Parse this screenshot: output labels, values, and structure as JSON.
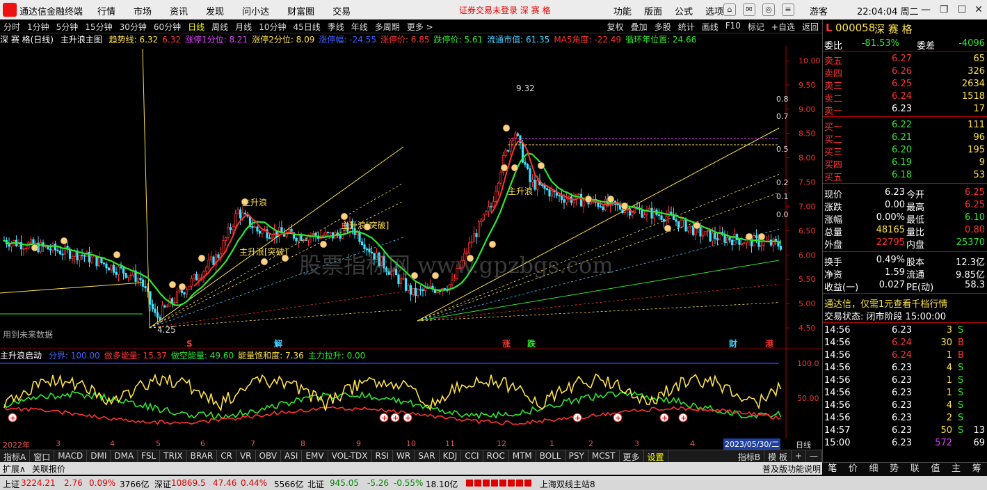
{
  "app": {
    "name": "通达信金融终端",
    "menu": [
      "行情",
      "市场",
      "资讯",
      "发现",
      "问小达",
      "财富圈",
      "交易"
    ],
    "warning": "证券交易未登录 深 赛 格",
    "menu2": [
      "功能",
      "版面",
      "公式",
      "选项"
    ],
    "user": "游客",
    "clock": "22:04:04 周二"
  },
  "periods": {
    "items": [
      "分时",
      "1分钟",
      "5分钟",
      "15分钟",
      "30分钟",
      "60分钟",
      "日线",
      "周线",
      "月线",
      "10分钟",
      "45日线",
      "季线",
      "年线",
      "多周期",
      "更多 >"
    ],
    "active": "日线",
    "right": [
      "复权",
      "叠加",
      "多股",
      "统计",
      "画线",
      "F10",
      "标记",
      "+自选",
      "返回"
    ]
  },
  "main_indicator": {
    "title": "深 赛 格(日线)",
    "formula": "主升浪主图",
    "items": [
      {
        "t": "趋势线: 6.32",
        "c": "#ffe14a"
      },
      {
        "t": "6.32",
        "c": "#ff3232"
      },
      {
        "t": "涨停1分位: 8.21",
        "c": "#e040ff"
      },
      {
        "t": "涨停2分位: 8.09",
        "c": "#ffe14a"
      },
      {
        "t": "涨停幅: -24.55",
        "c": "#4060ff"
      },
      {
        "t": "涨停价: 6.85",
        "c": "#ff3232"
      },
      {
        "t": "跌停价: 5.61",
        "c": "#2ee82e"
      },
      {
        "t": "流通市值: 61.35",
        "c": "#40d0ff"
      },
      {
        "t": "MA5角度: -22.49",
        "c": "#ff3232"
      },
      {
        "t": "循环年位置: 24.66",
        "c": "#2ee82e"
      }
    ]
  },
  "price_axis": [
    "10.00",
    "9.50",
    "9.00",
    "8.50",
    "8.00",
    "7.50",
    "7.00",
    "6.50",
    "6.00",
    "5.50",
    "5.00",
    "4.50"
  ],
  "fib_labels": [
    "0.8",
    "0.7",
    "0.5",
    "0.2",
    "0.1",
    "0.0"
  ],
  "annotations": {
    "high": "9.32",
    "low": "4.25",
    "wave": "主升浪",
    "breakout": "主升浪[突破]",
    "future": "用到未来数据",
    "watermark": "股票指标网 www.gpzbgs.com",
    "markers": [
      "S",
      "解",
      "涨",
      "跌",
      "财",
      "港"
    ]
  },
  "sub_indicator": {
    "title": "主升浪启动",
    "items": [
      {
        "t": "分界: 100.00",
        "c": "#4060ff"
      },
      {
        "t": "做多能量: 15.37",
        "c": "#ff3232"
      },
      {
        "t": "做空能量: 49.60",
        "c": "#2ee82e"
      },
      {
        "t": "能量饱和度: 7.36",
        "c": "#ffe14a"
      },
      {
        "t": "主力拉升: 0.00",
        "c": "#2ee82e"
      }
    ],
    "axis": [
      "100.0",
      "50.00"
    ]
  },
  "time_axis": {
    "labels": [
      "2022年",
      "3",
      "4",
      "5",
      "6",
      "7",
      "8",
      "9",
      "10",
      "11",
      "12",
      "1",
      "2",
      "3",
      "4"
    ],
    "cursor": "2023/05/30/二",
    "mode": "日线"
  },
  "ind_tabs": [
    "指标A",
    "窗口",
    "MACD",
    "DMI",
    "DMA",
    "FSL",
    "TRIX",
    "BRAR",
    "CR",
    "VR",
    "OBV",
    "ASI",
    "EMV",
    "VOL-TDX",
    "RSI",
    "WR",
    "SAR",
    "KDJ",
    "CCI",
    "ROC",
    "MTM",
    "BOLL",
    "PSY",
    "MCST",
    "更多",
    "设置"
  ],
  "ind_tabs_right": [
    "指标B",
    "模 板",
    "+",
    "—"
  ],
  "bottom_tabs": {
    "left": [
      "扩展∧",
      "关联报价"
    ],
    "right": "普及版功能说明"
  },
  "stock": {
    "code": "000058",
    "name": "深 赛 格",
    "wei_bi": "-81.53%",
    "wei_cha": "-4096",
    "asks": [
      {
        "l": "卖五",
        "p": "6.27",
        "v": "65"
      },
      {
        "l": "卖四",
        "p": "6.26",
        "v": "326"
      },
      {
        "l": "卖三",
        "p": "6.25",
        "v": "2634"
      },
      {
        "l": "卖二",
        "p": "6.24",
        "v": "1518"
      },
      {
        "l": "卖一",
        "p": "6.23",
        "v": "17"
      }
    ],
    "bids": [
      {
        "l": "买一",
        "p": "6.22",
        "v": "111"
      },
      {
        "l": "买二",
        "p": "6.21",
        "v": "96"
      },
      {
        "l": "买三",
        "p": "6.20",
        "v": "195"
      },
      {
        "l": "买四",
        "p": "6.19",
        "v": "9"
      },
      {
        "l": "买五",
        "p": "6.18",
        "v": "53"
      }
    ],
    "quote": [
      [
        "现价",
        "6.23",
        "今开",
        "6.25"
      ],
      [
        "涨跌",
        "0.00",
        "最高",
        "6.25"
      ],
      [
        "涨幅",
        "0.00%",
        "最低",
        "6.10"
      ],
      [
        "总量",
        "48165",
        "量比",
        "0.80"
      ],
      [
        "外盘",
        "22795",
        "内盘",
        "25370"
      ]
    ],
    "stats": [
      [
        "换手",
        "0.49%",
        "股本",
        "12.3亿"
      ],
      [
        "净资",
        "1.59",
        "流通",
        "9.85亿"
      ],
      [
        "收益(一)",
        "0.027",
        "PE(动)",
        "58.3"
      ]
    ],
    "promo": "通达信，仅需1元查看千档行情",
    "trade_state": "交易状态: 闭市阶段 15:00:00",
    "ticks": [
      [
        "14:56",
        "6.23",
        "3",
        "S"
      ],
      [
        "14:56",
        "6.24",
        "30",
        "B"
      ],
      [
        "14:56",
        "6.24",
        "1",
        "B"
      ],
      [
        "14:56",
        "6.23",
        "4",
        "S"
      ],
      [
        "14:56",
        "6.23",
        "1",
        "S"
      ],
      [
        "14:56",
        "6.23",
        "1",
        "S"
      ],
      [
        "14:56",
        "6.23",
        "4",
        "S"
      ],
      [
        "14:56",
        "6.23",
        "2",
        "S"
      ],
      [
        "14:57",
        "6.23",
        "50",
        "S",
        "13"
      ],
      [
        "15:00",
        "6.23",
        "572",
        "",
        "69"
      ]
    ],
    "rtabs": [
      "笔",
      "价",
      "细",
      "势",
      "联",
      "值",
      "主",
      "筹"
    ]
  },
  "status": {
    "sh_name": "上证",
    "sh": "3224.21",
    "sh_chg": "2.76",
    "sh_pct": "0.09%",
    "sh_amt": "3766亿",
    "sz_name": "深证",
    "sz": "10869.5",
    "sz_chg": "47.46",
    "sz_pct": "0.44%",
    "sz_amt": "5566亿",
    "bz_name": "北证",
    "bz": "945.05",
    "bz_chg": "-5.26",
    "bz_pct": "-0.55%",
    "bz_amt": "18.10亿",
    "server": "上海双线主站8"
  },
  "colors": {
    "up": "#ff3232",
    "down": "#2ee82e",
    "ma": "#2ee82e",
    "trend": "#ff3232"
  }
}
